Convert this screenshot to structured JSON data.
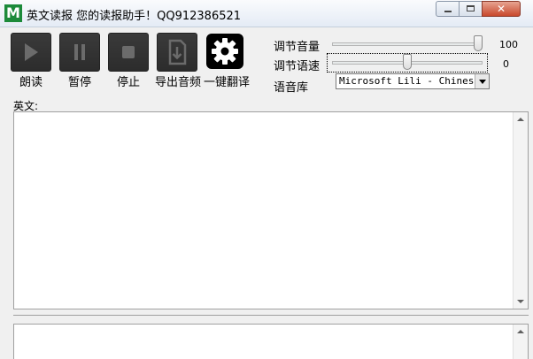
{
  "window": {
    "app_icon_letter": "M",
    "title": "英文读报 您的读报助手！QQ912386521",
    "close_glyph": "✕"
  },
  "toolbar": {
    "buttons": [
      {
        "label": "朗读",
        "icon": "play-icon"
      },
      {
        "label": "暂停",
        "icon": "pause-icon"
      },
      {
        "label": "停止",
        "icon": "stop-icon"
      },
      {
        "label": "导出音频",
        "icon": "export-file-icon"
      },
      {
        "label": "一键翻译",
        "icon": "gear-icon"
      }
    ]
  },
  "controls": {
    "volume": {
      "label": "调节音量",
      "value": "100",
      "level": 1.0
    },
    "speed": {
      "label": "调节语速",
      "value": "0",
      "level": 0.5
    },
    "voice": {
      "label": "语音库",
      "selected": "Microsoft Lili - Chinese"
    }
  },
  "editor": {
    "english_label": "英文:",
    "english_text": "",
    "translation_text": ""
  },
  "colors": {
    "app_icon": "#1c8a3a",
    "tool_button": "#2f2f2f",
    "close_button": "#c8482c"
  }
}
